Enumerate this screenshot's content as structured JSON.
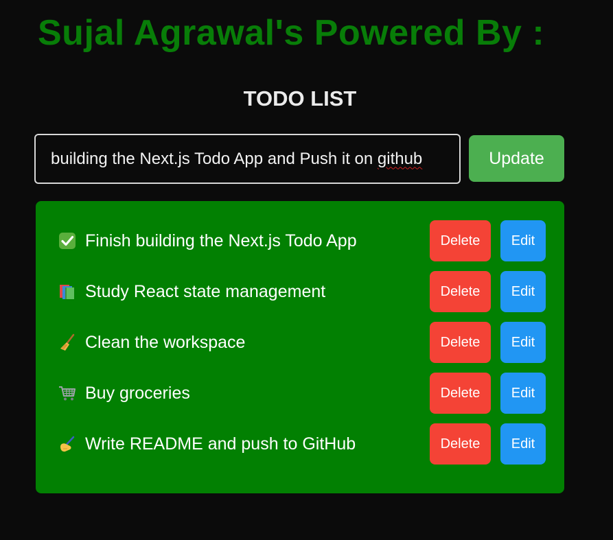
{
  "header": {
    "brand_title": "Sujal Agrawal's Powered By :",
    "section_title": "TODO LIST"
  },
  "form": {
    "input_value_prefix": "building the Next.js Todo App and Push it on ",
    "input_value_misspelled": "github",
    "update_label": "Update"
  },
  "todos": [
    {
      "icon": "check-mark-icon",
      "text": "Finish building the Next.js Todo App",
      "delete_label": "Delete",
      "edit_label": "Edit"
    },
    {
      "icon": "books-icon",
      "text": "Study React state management",
      "delete_label": "Delete",
      "edit_label": "Edit"
    },
    {
      "icon": "broom-icon",
      "text": "Clean the workspace",
      "delete_label": "Delete",
      "edit_label": "Edit"
    },
    {
      "icon": "shopping-cart-icon",
      "text": "Buy groceries",
      "delete_label": "Delete",
      "edit_label": "Edit"
    },
    {
      "icon": "writing-hand-icon",
      "text": "Write README and push to GitHub",
      "delete_label": "Delete",
      "edit_label": "Edit"
    }
  ],
  "colors": {
    "background": "#0b0b0b",
    "brand_title": "#087d08",
    "panel": "#028002",
    "update_button": "#4caf50",
    "delete_button": "#f44336",
    "edit_button": "#2196f3"
  }
}
